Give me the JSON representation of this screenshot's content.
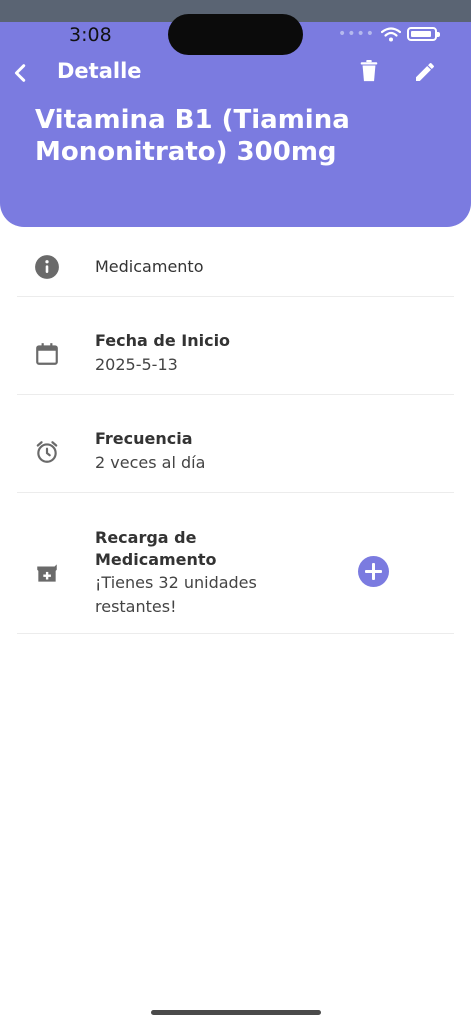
{
  "status_bar": {
    "time": "3:08"
  },
  "header": {
    "nav_title": "Detalle",
    "title": "Vitamina B1 (Tiamina Mononitrato) 300mg",
    "accent": "#7b7be0"
  },
  "rows": {
    "type_label": "Medicamento",
    "start_label": "Fecha de Inicio",
    "start_value": "2025-5-13",
    "frequency_label": "Frecuencia",
    "frequency_value": "2 veces al día",
    "refill_label": "Recarga de Medicamento",
    "refill_value": "¡Tienes 32 unidades restantes!"
  },
  "icons": {
    "back": "chevron-left-icon",
    "trash": "trash-icon",
    "edit": "pencil-icon",
    "info": "info-icon",
    "calendar": "calendar-icon",
    "alarm": "alarm-clock-icon",
    "medication": "medication-icon",
    "add": "add-circle-icon"
  }
}
